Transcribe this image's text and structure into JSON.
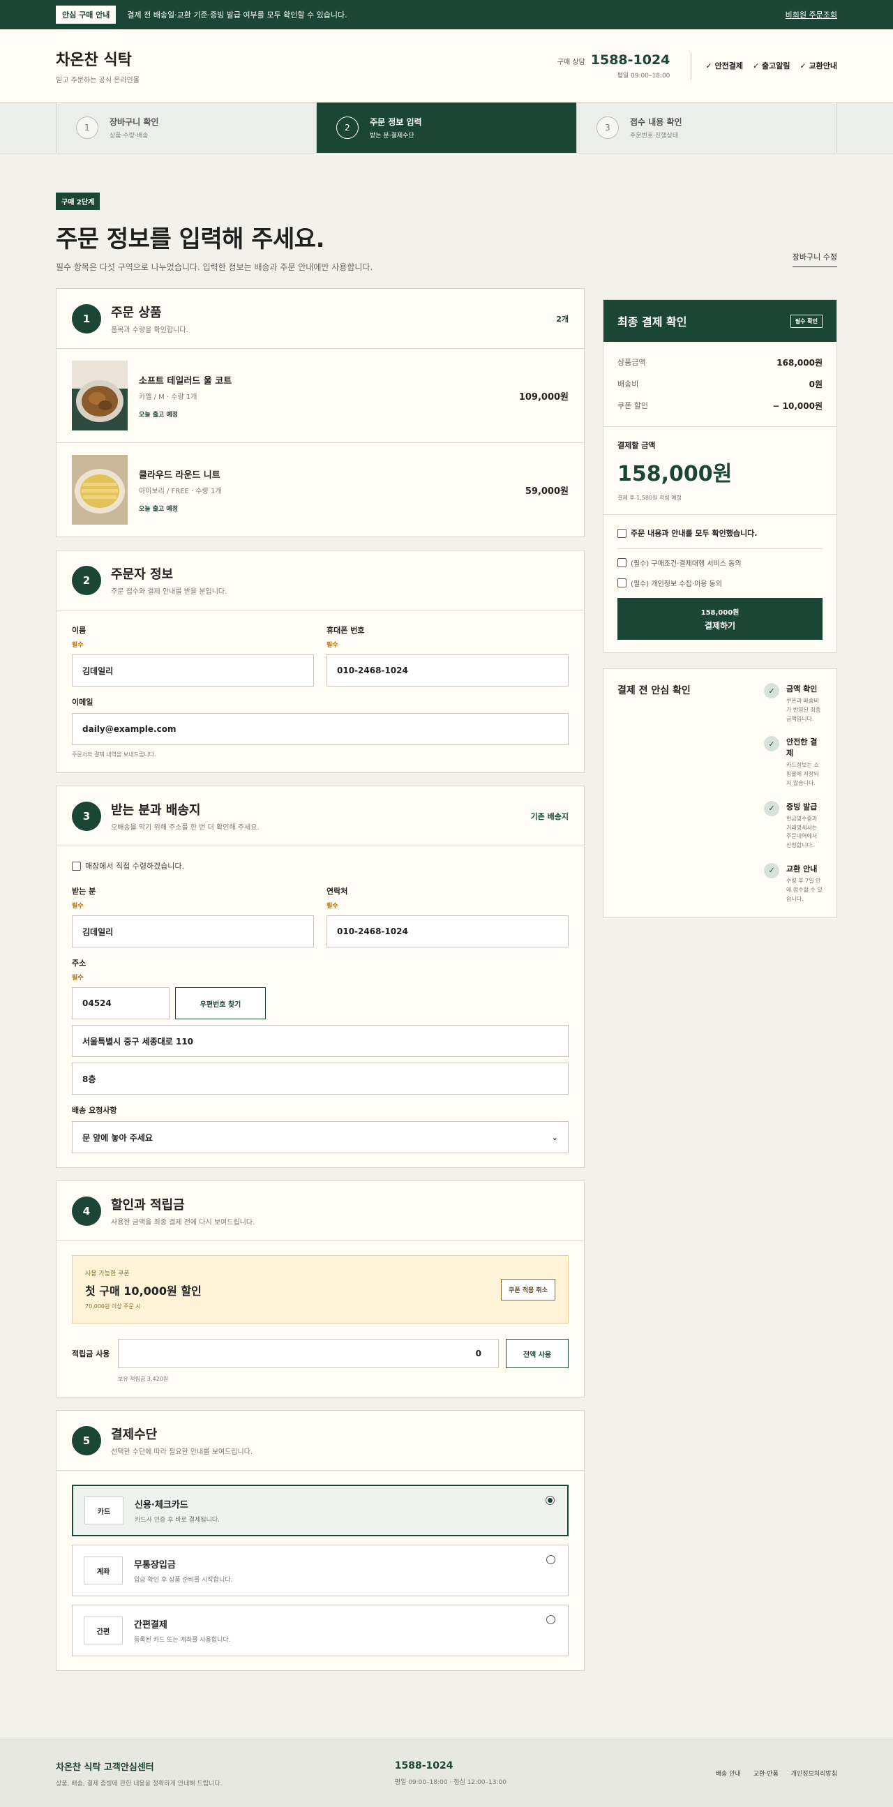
{
  "topbar": {
    "badge": "안심 구매 안내",
    "message": "결제 전 배송일·교환 기준·증빙 발급 여부를 모두 확인할 수 있습니다.",
    "guest_lookup": "비회원 주문조회"
  },
  "header": {
    "brand": "차온찬 식탁",
    "tagline": "믿고 주문하는 공식 온라인몰",
    "contact_label": "구매 상담",
    "phone": "1588-1024",
    "hours": "평일 09:00–18:00",
    "trust": [
      "안전결제",
      "출고알림",
      "교환안내"
    ]
  },
  "steps": [
    {
      "num": "1",
      "title": "장바구니 확인",
      "sub": "상품·수량·배송"
    },
    {
      "num": "2",
      "title": "주문 정보 입력",
      "sub": "받는 분·결제수단"
    },
    {
      "num": "3",
      "title": "접수 내용 확인",
      "sub": "주문번호·진행상태"
    }
  ],
  "page": {
    "stage": "구매 2단계",
    "title": "주문 정보를 입력해 주세요.",
    "desc": "필수 항목은 다섯 구역으로 나누었습니다. 입력한 정보는 배송과 주문 안내에만 사용합니다.",
    "cart_edit": "장바구니 수정"
  },
  "sec1": {
    "num": "1",
    "title": "주문 상품",
    "sub": "품목과 수량을 확인합니다.",
    "count": "2개",
    "products": [
      {
        "name": "소프트 테일러드 울 코트",
        "opt": "카멜 / M · 수량 1개",
        "ship": "오늘 출고 예정",
        "price": "109,000원"
      },
      {
        "name": "클라우드 라운드 니트",
        "opt": "아이보리 / FREE · 수량 1개",
        "ship": "오늘 출고 예정",
        "price": "59,000원"
      }
    ]
  },
  "sec2": {
    "num": "2",
    "title": "주문자 정보",
    "sub": "주문 접수와 결제 안내를 받을 분입니다.",
    "name_label": "이름",
    "name_req": "필수",
    "name_val": "김데일리",
    "phone_label": "휴대폰 번호",
    "phone_req": "필수",
    "phone_val": "010-2468-1024",
    "email_label": "이메일",
    "email_val": "daily@example.com",
    "email_hint": "주문서와 결제 내역을 보내드립니다."
  },
  "sec3": {
    "num": "3",
    "title": "받는 분과 배송지",
    "sub": "오배송을 막기 위해 주소를 한 번 더 확인해 주세요.",
    "default_addr": "기존 배송지",
    "pickup": "매장에서 직접 수령하겠습니다.",
    "recv_label": "받는 분",
    "recv_req": "필수",
    "recv_val": "김데일리",
    "contact_label": "연락처",
    "contact_req": "필수",
    "contact_val": "010-2468-1024",
    "addr_label": "주소",
    "addr_req": "필수",
    "zip": "04524",
    "zip_btn": "우편번호 찾기",
    "addr1": "서울특별시 중구 세종대로 110",
    "addr2": "8층",
    "req_label": "배송 요청사항",
    "req_val": "문 앞에 놓아 주세요"
  },
  "sec4": {
    "num": "4",
    "title": "할인과 적립금",
    "sub": "사용한 금액을 최종 결제 전에 다시 보여드립니다.",
    "coupon_small": "사용 가능한 쿠폰",
    "coupon_title": "첫 구매 10,000원 할인",
    "coupon_cond": "70,000원 이상 주문 시",
    "coupon_btn": "쿠폰 적용 취소",
    "points_label": "적립금 사용",
    "points_val": "0",
    "points_btn": "전액 사용",
    "points_hint": "보유 적립금 3,420원"
  },
  "sec5": {
    "num": "5",
    "title": "결제수단",
    "sub": "선택한 수단에 따라 필요한 안내를 보여드립니다.",
    "options": [
      {
        "tag": "카드",
        "title": "신용·체크카드",
        "sub": "카드사 인증 후 바로 결제됩니다."
      },
      {
        "tag": "계좌",
        "title": "무통장입금",
        "sub": "입금 확인 후 상품 준비를 시작합니다."
      },
      {
        "tag": "간편",
        "title": "간편결제",
        "sub": "등록된 카드 또는 계좌를 사용합니다."
      }
    ]
  },
  "summary": {
    "title": "최종 결제 확인",
    "badge": "필수 확인",
    "rows": [
      {
        "label": "상품금액",
        "value": "168,000원"
      },
      {
        "label": "배송비",
        "value": "0원"
      },
      {
        "label": "쿠폰 할인",
        "value": "− 10,000원"
      }
    ],
    "total_label": "결제할 금액",
    "total": "158,000원",
    "points_note": "결제 후 1,580원 적립 예정",
    "agree_all": "주문 내용과 안내를 모두 확인했습니다.",
    "agree1": "(필수) 구매조건·결제대행 서비스 동의",
    "agree2": "(필수) 개인정보 수집·이용 동의",
    "pay_amount": "158,000원",
    "pay_label": "결제하기"
  },
  "safety": {
    "title": "결제 전 안심 확인",
    "items": [
      {
        "t": "금액 확인",
        "d": "쿠폰과 배송비가 반영된 최종 금액입니다."
      },
      {
        "t": "안전한 결제",
        "d": "카드정보는 쇼핑몰에 저장되지 않습니다."
      },
      {
        "t": "증빙 발급",
        "d": "현금영수증과 거래명세서는 주문내역에서 신청합니다."
      },
      {
        "t": "교환 안내",
        "d": "수령 후 7일 안에 접수할 수 있습니다."
      }
    ]
  },
  "footer": {
    "title": "차온찬 식탁 고객안심센터",
    "sub": "상품, 배송, 결제 증빙에 관한 내용을 정확하게 안내해 드립니다.",
    "phone": "1588-1024",
    "hours": "평일 09:00–18:00 · 점심 12:00–13:00",
    "links": [
      "배송 안내",
      "교환·반품",
      "개인정보처리방침"
    ]
  },
  "colors": {
    "brand": "#1b4535",
    "background": "#f3f1ec",
    "card": "#fffdf6",
    "coupon": "#fff3d8"
  }
}
